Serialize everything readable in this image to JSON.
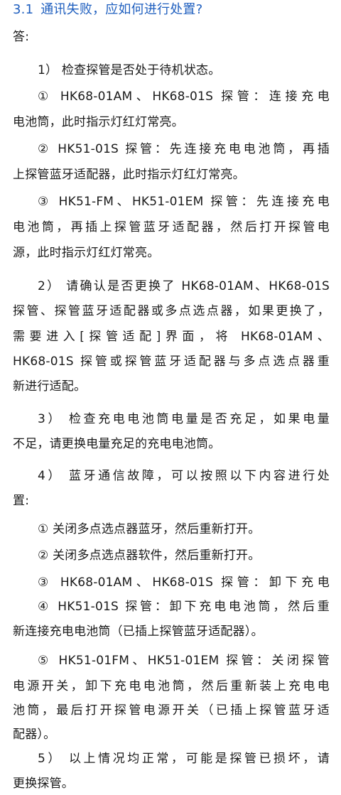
{
  "section": {
    "number": "3.1",
    "title": "通讯失败，应如何进行处置?",
    "color": "#1f5fbf"
  },
  "answer_label": "答:",
  "lines": [
    "1） 检查探管是否处于待机状态。",
    "① HK68-01AM、HK68-01S 探管：连接充电",
    "电池筒，此时指示灯红灯常亮。",
    "② HK51-01S 探管：先连接充电电池筒，再插",
    "上探管蓝牙适配器，此时指示灯红灯常亮。",
    "③ HK51-FM、HK51-01EM 探管：先连接充电",
    "电池筒，再插上探管蓝牙适配器，然后打开探管电",
    "源，此时指示灯红灯常亮。",
    "2） 请确认是否更换了 HK68-01AM、HK68-01S",
    "探管、探管蓝牙适配器或多点选点器，如果更换了，",
    "需要进入[探管适配]界面，将 HK68-01AM、",
    "HK68-01S 探管或探管蓝牙适配器与多点选点器重",
    "新进行适配。",
    "3） 检查充电电池筒电量是否充足，如果电量",
    "不足，请更换电量充足的充电电池筒。",
    "4） 蓝牙通信故障，可以按照以下内容进行处",
    "置:",
    "① 关闭多点选点器蓝牙，然后重新打开。",
    "② 关闭多点选点器软件，然后重新打开。",
    "③ HK68-01AM、HK68-01S 探管：卸下充电",
    "④ HK51-01S 探管：卸下充电电池筒，然后重",
    "新连接充电电池筒（已插上探管蓝牙适配器）。",
    "⑤ HK51-01FM、HK51-01EM 探管：关闭探管",
    "电源开关，卸下充电电池筒，然后重新装上充电电",
    "池筒，最后打开探管电源开关（已插上探管蓝牙适",
    "配器）。",
    "5） 以上情况均正常，可能是探管已损坏，请",
    "更换探管。"
  ]
}
